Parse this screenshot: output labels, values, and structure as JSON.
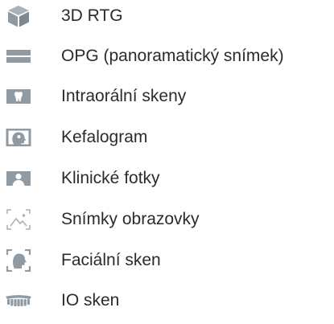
{
  "colors": {
    "icon": "#8f9aa3",
    "icon_dark": "#6f7a83",
    "text": "#2b2b2b"
  },
  "items": [
    {
      "label": "3D RTG",
      "icon": "cube-icon"
    },
    {
      "label": "OPG (panoramatický snímek)",
      "icon": "panoramic-icon"
    },
    {
      "label": "Intraorální skeny",
      "icon": "tooth-icon"
    },
    {
      "label": "Kefalogram",
      "icon": "cephalogram-icon"
    },
    {
      "label": "Klinické fotky",
      "icon": "person-photo-icon"
    },
    {
      "label": "Snímky obrazovky",
      "icon": "screenshot-icon"
    },
    {
      "label": "Faciální sken",
      "icon": "face-scan-icon"
    },
    {
      "label": "IO sken",
      "icon": "dental-arch-icon"
    }
  ]
}
